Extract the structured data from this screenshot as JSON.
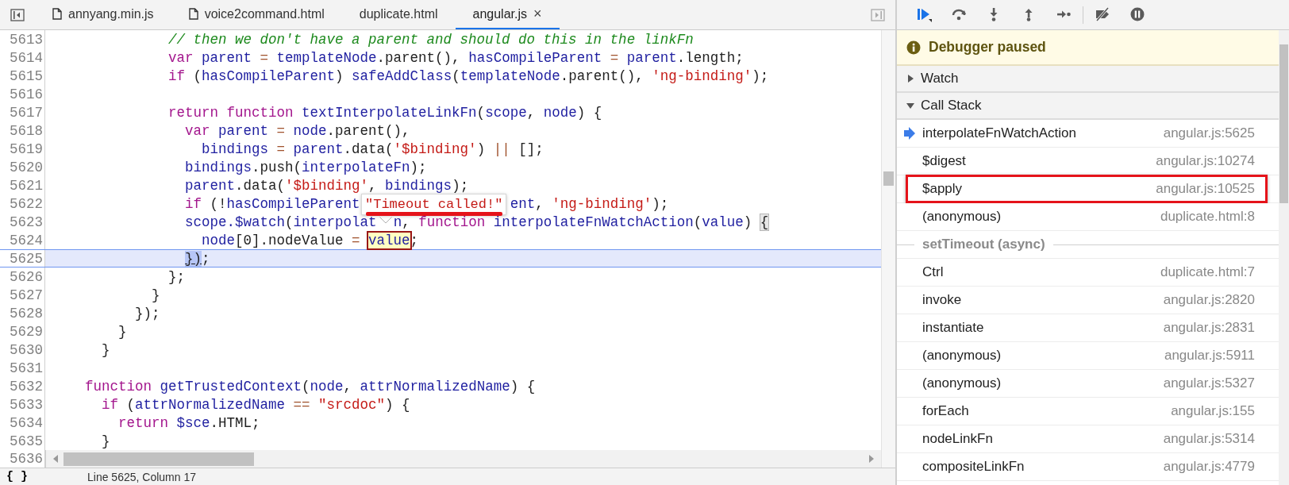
{
  "editor": {
    "tabs": [
      {
        "label": "annyang.min.js",
        "file_icon": true,
        "selected": false
      },
      {
        "label": "voice2command.html",
        "file_icon": true,
        "selected": false
      },
      {
        "label": "duplicate.html",
        "file_icon": false,
        "selected": false
      },
      {
        "label": "angular.js",
        "file_icon": false,
        "selected": true,
        "close": "×"
      }
    ],
    "lines": [
      {
        "number": "5613",
        "current": false,
        "segments": [
          [
            {
              "kind": "comment",
              "text": "              // then we don't have a parent and should do this in the linkFn"
            }
          ]
        ]
      },
      {
        "number": "5614",
        "current": false,
        "segments": [
          [
            {
              "kind": "keyword",
              "text": "              var "
            },
            {
              "kind": "name",
              "text": "parent"
            },
            {
              "kind": "operator",
              "text": " = "
            },
            {
              "kind": "name",
              "text": "templateNode"
            },
            {
              "kind": "plain",
              "text": ".parent(), "
            },
            {
              "kind": "name",
              "text": "hasCompileParent"
            },
            {
              "kind": "operator",
              "text": " = "
            },
            {
              "kind": "name",
              "text": "parent"
            },
            {
              "kind": "plain",
              "text": ".length;"
            }
          ]
        ]
      },
      {
        "number": "5615",
        "current": false,
        "segments": [
          [
            {
              "kind": "keyword",
              "text": "              if"
            },
            {
              "kind": "plain",
              "text": " ("
            },
            {
              "kind": "name",
              "text": "hasCompileParent"
            },
            {
              "kind": "plain",
              "text": ") "
            },
            {
              "kind": "name",
              "text": "safeAddClass"
            },
            {
              "kind": "plain",
              "text": "("
            },
            {
              "kind": "name",
              "text": "templateNode"
            },
            {
              "kind": "plain",
              "text": ".parent(), "
            },
            {
              "kind": "string",
              "text": "'ng-binding'"
            },
            {
              "kind": "plain",
              "text": ");"
            }
          ]
        ]
      },
      {
        "number": "5616",
        "current": false
      },
      {
        "number": "5617",
        "current": false,
        "segments": [
          [
            {
              "kind": "keyword",
              "text": "              return "
            },
            {
              "kind": "keyword",
              "text": "function "
            },
            {
              "kind": "name",
              "text": "textInterpolateLinkFn"
            },
            {
              "kind": "plain",
              "text": "("
            },
            {
              "kind": "name",
              "text": "scope"
            },
            {
              "kind": "plain",
              "text": ", "
            },
            {
              "kind": "name",
              "text": "node"
            },
            {
              "kind": "plain",
              "text": ") {"
            }
          ]
        ]
      },
      {
        "number": "5618",
        "current": false,
        "segments": [
          [
            {
              "kind": "keyword",
              "text": "                var "
            },
            {
              "kind": "name",
              "text": "parent"
            },
            {
              "kind": "operator",
              "text": " = "
            },
            {
              "kind": "name",
              "text": "node"
            },
            {
              "kind": "plain",
              "text": ".parent(),"
            }
          ]
        ]
      },
      {
        "number": "5619",
        "current": false,
        "segments": [
          [
            {
              "kind": "name",
              "text": "                  bindings"
            },
            {
              "kind": "operator",
              "text": " = "
            },
            {
              "kind": "name",
              "text": "parent"
            },
            {
              "kind": "plain",
              "text": ".data("
            },
            {
              "kind": "string",
              "text": "'$binding'"
            },
            {
              "kind": "plain",
              "text": ") "
            },
            {
              "kind": "operator",
              "text": "||"
            },
            {
              "kind": "plain",
              "text": " [];"
            }
          ]
        ]
      },
      {
        "number": "5620",
        "current": false,
        "segments": [
          [
            {
              "kind": "name",
              "text": "                bindings"
            },
            {
              "kind": "plain",
              "text": ".push("
            },
            {
              "kind": "name",
              "text": "interpolateFn"
            },
            {
              "kind": "plain",
              "text": ");"
            }
          ]
        ]
      },
      {
        "number": "5621",
        "current": false,
        "segments": [
          [
            {
              "kind": "name",
              "text": "                parent"
            },
            {
              "kind": "plain",
              "text": ".data("
            },
            {
              "kind": "string",
              "text": "'$binding'"
            },
            {
              "kind": "plain",
              "text": ", "
            },
            {
              "kind": "name",
              "text": "bindings"
            },
            {
              "kind": "plain",
              "text": ");"
            }
          ]
        ]
      },
      {
        "number": "5622",
        "current": false,
        "segments": [
          [
            {
              "kind": "keyword",
              "text": "                if"
            },
            {
              "kind": "plain",
              "text": " (!"
            },
            {
              "kind": "name",
              "text": "hasCompileParent"
            }
          ],
          [
            {
              "kind": "name",
              "text": "                  ent"
            },
            {
              "kind": "plain",
              "text": ", "
            },
            {
              "kind": "string",
              "text": "'ng-binding'"
            },
            {
              "kind": "plain",
              "text": ");"
            }
          ]
        ]
      },
      {
        "number": "5623",
        "current": false,
        "segments": [
          [
            {
              "kind": "name",
              "text": "                scope.$watch"
            },
            {
              "kind": "plain",
              "text": "("
            },
            {
              "kind": "name",
              "text": "interpolat"
            }
          ],
          [
            {
              "kind": "name",
              "text": "  n"
            },
            {
              "kind": "plain",
              "text": ", "
            },
            {
              "kind": "keyword",
              "text": "function "
            },
            {
              "kind": "name",
              "text": "interpolateFnWatchAction"
            },
            {
              "kind": "plain",
              "text": "("
            },
            {
              "kind": "name",
              "text": "value"
            },
            {
              "kind": "plain",
              "text": ") "
            },
            {
              "kind": "match",
              "text": "{"
            }
          ]
        ]
      },
      {
        "number": "5624",
        "current": false,
        "segments": [
          [
            {
              "kind": "name",
              "text": "                  node"
            },
            {
              "kind": "plain",
              "text": "[0].nodeValue"
            },
            {
              "kind": "operator",
              "text": " = "
            },
            {
              "kind": "hover",
              "text": "value"
            },
            {
              "kind": "plain",
              "text": ";"
            }
          ]
        ]
      },
      {
        "number": "5625",
        "current": true,
        "segments": [
          [
            {
              "kind": "exec",
              "text": "                })"
            },
            {
              "kind": "plain",
              "text": ";"
            }
          ]
        ]
      },
      {
        "number": "5626",
        "current": false,
        "segments": [
          [
            {
              "kind": "plain",
              "text": "              };"
            }
          ]
        ]
      },
      {
        "number": "5627",
        "current": false,
        "segments": [
          [
            {
              "kind": "plain",
              "text": "            }"
            }
          ]
        ]
      },
      {
        "number": "5628",
        "current": false,
        "segments": [
          [
            {
              "kind": "plain",
              "text": "          });"
            }
          ]
        ]
      },
      {
        "number": "5629",
        "current": false,
        "segments": [
          [
            {
              "kind": "plain",
              "text": "        }"
            }
          ]
        ]
      },
      {
        "number": "5630",
        "current": false,
        "segments": [
          [
            {
              "kind": "plain",
              "text": "      }"
            }
          ]
        ]
      },
      {
        "number": "5631",
        "current": false
      },
      {
        "number": "5632",
        "current": false,
        "segments": [
          [
            {
              "kind": "keyword",
              "text": "    function "
            },
            {
              "kind": "name",
              "text": "getTrustedContext"
            },
            {
              "kind": "plain",
              "text": "("
            },
            {
              "kind": "name",
              "text": "node"
            },
            {
              "kind": "plain",
              "text": ", "
            },
            {
              "kind": "name",
              "text": "attrNormalizedName"
            },
            {
              "kind": "plain",
              "text": ") {"
            }
          ]
        ]
      },
      {
        "number": "5633",
        "current": false,
        "segments": [
          [
            {
              "kind": "keyword",
              "text": "      if"
            },
            {
              "kind": "plain",
              "text": " ("
            },
            {
              "kind": "name",
              "text": "attrNormalizedName"
            },
            {
              "kind": "operator",
              "text": " == "
            },
            {
              "kind": "string",
              "text": "\"srcdoc\""
            },
            {
              "kind": "plain",
              "text": ") {"
            }
          ]
        ]
      },
      {
        "number": "5634",
        "current": false,
        "segments": [
          [
            {
              "kind": "keyword",
              "text": "        return "
            },
            {
              "kind": "name",
              "text": "$sce"
            },
            {
              "kind": "plain",
              "text": ".HTML;"
            }
          ]
        ]
      },
      {
        "number": "5635",
        "current": false,
        "segments": [
          [
            {
              "kind": "plain",
              "text": "      }"
            }
          ]
        ]
      }
    ],
    "last_line_number": "5636",
    "tooltip": {
      "text": "\"Timeout called!\"",
      "underlined": true
    },
    "status_bar": {
      "format_button": "{ }",
      "position": "Line 5625, Column 17"
    }
  },
  "debugger": {
    "toolbar": [
      {
        "kind": "resume",
        "active": true
      },
      {
        "kind": "step-over",
        "active": false
      },
      {
        "kind": "step-into",
        "active": false
      },
      {
        "kind": "step-out",
        "active": false
      },
      {
        "kind": "step",
        "active": false
      },
      {
        "kind": "deactivate",
        "active": false
      },
      {
        "kind": "pause-exceptions",
        "active": false
      }
    ],
    "banner": "Debugger paused",
    "sections": [
      {
        "label": "Watch",
        "expanded": false
      },
      {
        "label": "Call Stack",
        "expanded": true
      }
    ],
    "call_stack": [
      {
        "kind": "frame",
        "name": "interpolateFnWatchAction",
        "location": "angular.js:5625",
        "selected": true,
        "boxed": false
      },
      {
        "kind": "frame",
        "name": "$digest",
        "location": "angular.js:10274",
        "selected": false,
        "boxed": false
      },
      {
        "kind": "frame",
        "name": "$apply",
        "location": "angular.js:10525",
        "selected": false,
        "boxed": true
      },
      {
        "kind": "frame",
        "name": "(anonymous)",
        "location": "duplicate.html:8",
        "selected": false,
        "boxed": false
      },
      {
        "kind": "async",
        "name": "setTimeout (async)"
      },
      {
        "kind": "frame",
        "name": "Ctrl",
        "location": "duplicate.html:7",
        "selected": false,
        "boxed": false
      },
      {
        "kind": "frame",
        "name": "invoke",
        "location": "angular.js:2820",
        "selected": false,
        "boxed": false
      },
      {
        "kind": "frame",
        "name": "instantiate",
        "location": "angular.js:2831",
        "selected": false,
        "boxed": false
      },
      {
        "kind": "frame",
        "name": "(anonymous)",
        "location": "angular.js:5911",
        "selected": false,
        "boxed": false
      },
      {
        "kind": "frame",
        "name": "(anonymous)",
        "location": "angular.js:5327",
        "selected": false,
        "boxed": false
      },
      {
        "kind": "frame",
        "name": "forEach",
        "location": "angular.js:155",
        "selected": false,
        "boxed": false
      },
      {
        "kind": "frame",
        "name": "nodeLinkFn",
        "location": "angular.js:5314",
        "selected": false,
        "boxed": false
      },
      {
        "kind": "frame",
        "name": "compositeLinkFn",
        "location": "angular.js:4779",
        "selected": false,
        "boxed": false
      }
    ]
  }
}
